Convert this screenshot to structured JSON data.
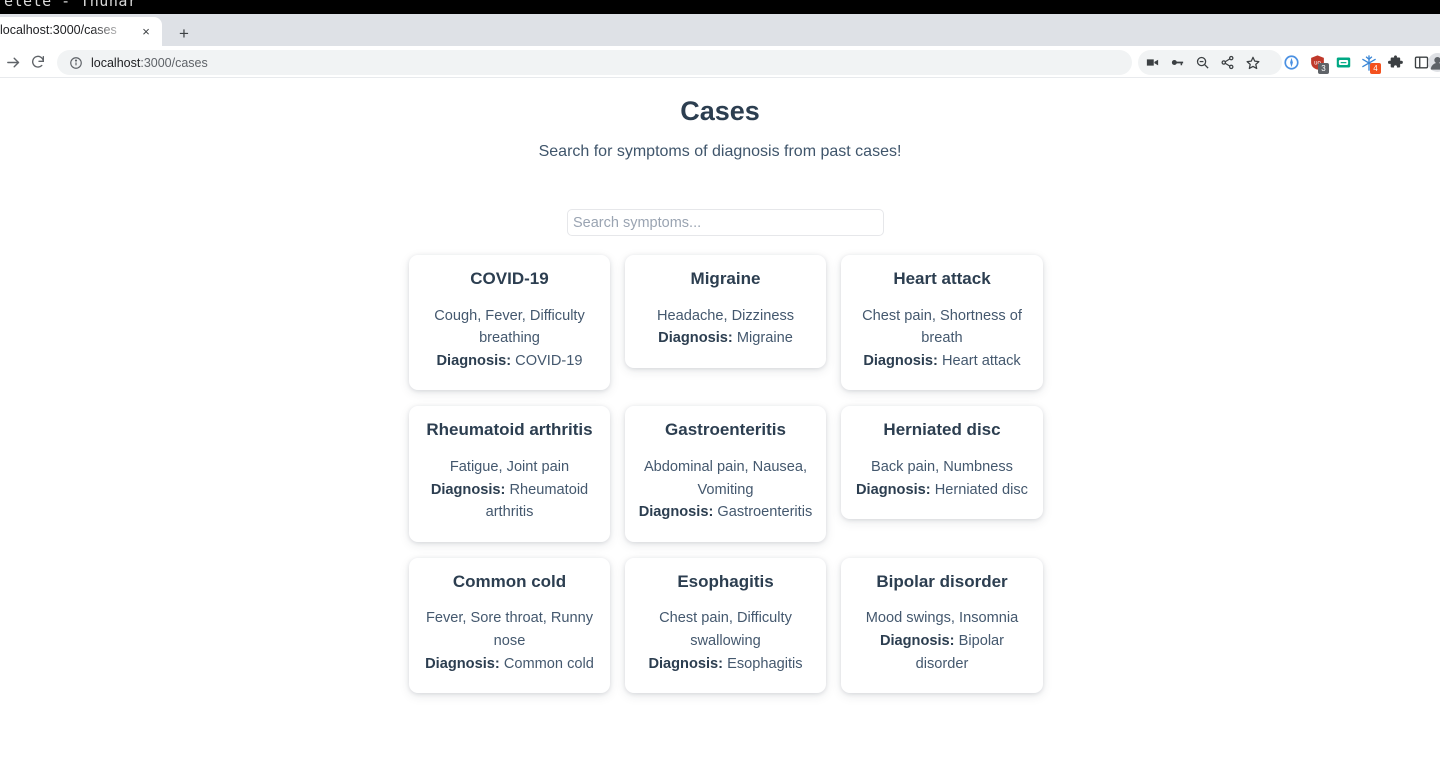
{
  "os_window": {
    "title": "elete  -  Thunar"
  },
  "browser": {
    "tab": {
      "title": "localhost:3000/cases",
      "close_label": "×"
    },
    "new_tab_label": "+",
    "nav": {
      "forward_icon": "forward-arrow-icon",
      "reload_icon": "reload-icon"
    },
    "omnibox": {
      "info_icon": "site-info-icon",
      "url_host": "localhost",
      "url_path": ":3000/cases",
      "url_full": "localhost:3000/cases"
    },
    "toolbar_icons": [
      {
        "name": "screen-record-icon",
        "glyph": "■"
      },
      {
        "name": "password-key-icon",
        "glyph": "⚷"
      },
      {
        "name": "zoom-out-icon",
        "glyph": "⊖"
      },
      {
        "name": "share-icon",
        "glyph": "≪"
      },
      {
        "name": "bookmark-star-icon",
        "glyph": "☆"
      }
    ],
    "extensions": [
      {
        "name": "compass-extension-icon",
        "color": "#4a90e2",
        "badge": ""
      },
      {
        "name": "ublock-origin-icon",
        "color": "#c0392b",
        "badge": "3",
        "badge_color": "#5f6368"
      },
      {
        "name": "mail-extension-icon",
        "color": "#00a884",
        "badge": ""
      },
      {
        "name": "snowflake-extension-icon",
        "color": "#3a86d6",
        "badge": "4",
        "badge_color": "#f4511e"
      },
      {
        "name": "extensions-puzzle-icon",
        "color": "#3c4043",
        "badge": ""
      },
      {
        "name": "side-panel-icon",
        "color": "#3c4043",
        "badge": ""
      }
    ],
    "profile_avatar": "profile-avatar"
  },
  "page": {
    "title": "Cases",
    "subtitle": "Search for symptoms of diagnosis from past cases!",
    "search": {
      "placeholder": "Search symptoms...",
      "value": ""
    },
    "diagnosis_label": "Diagnosis:",
    "cards": [
      {
        "title": "COVID-19",
        "symptoms": "Cough, Fever, Difficulty breathing",
        "diagnosis_label": "Diagnosis:",
        "diagnosis": "COVID-19"
      },
      {
        "title": "Migraine",
        "symptoms": "Headache, Dizziness",
        "diagnosis_label": "Diagnosis:",
        "diagnosis": "Migraine"
      },
      {
        "title": "Heart attack",
        "symptoms": "Chest pain, Shortness of breath",
        "diagnosis_label": "Diagnosis:",
        "diagnosis": "Heart attack"
      },
      {
        "title": "Rheumatoid arthritis",
        "symptoms": "Fatigue, Joint pain",
        "diagnosis_label": "Diagnosis:",
        "diagnosis": "Rheumatoid arthritis"
      },
      {
        "title": "Gastroenteritis",
        "symptoms": "Abdominal pain, Nausea, Vomiting",
        "diagnosis_label": "Diagnosis:",
        "diagnosis": "Gastroenteritis"
      },
      {
        "title": "Herniated disc",
        "symptoms": "Back pain, Numbness",
        "diagnosis_label": "Diagnosis:",
        "diagnosis": "Herniated disc"
      },
      {
        "title": "Common cold",
        "symptoms": "Fever, Sore throat, Runny nose",
        "diagnosis_label": "Diagnosis:",
        "diagnosis": "Common cold"
      },
      {
        "title": "Esophagitis",
        "symptoms": "Chest pain, Difficulty swallowing",
        "diagnosis_label": "Diagnosis:",
        "diagnosis": "Esophagitis"
      },
      {
        "title": "Bipolar disorder",
        "symptoms": "Mood swings, Insomnia",
        "diagnosis_label": "Diagnosis:",
        "diagnosis": "Bipolar disorder"
      }
    ]
  },
  "colors": {
    "title": "#2c3e50",
    "body_text": "#44586e",
    "page_bg": "#ffffff",
    "tabstrip_bg": "#dee1e6",
    "omnibox_bg": "#f1f3f4"
  }
}
